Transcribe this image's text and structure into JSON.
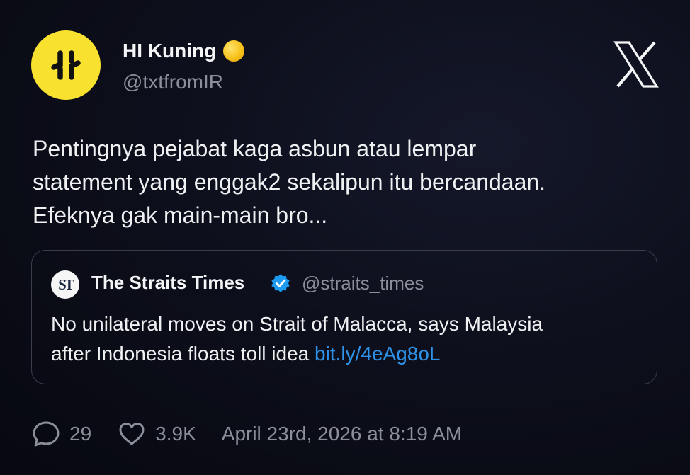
{
  "author": {
    "display_name": "HI Kuning",
    "handle": "@txtfromIR",
    "avatar_color": "#f9e12f",
    "badge_icon": "yellow-circle-emoji-icon"
  },
  "platform_logo": "x-logo-icon",
  "tweet": {
    "lines": [
      "Pentingnya pejabat kaga asbun atau lempar",
      "statement yang enggak2 sekalipun itu bercandaan.",
      "Efeknya gak main-main bro..."
    ]
  },
  "quote": {
    "avatar_text": "ST",
    "display_name": "The Straits Times",
    "verified_icon": "verified-badge-icon",
    "handle": "@straits_times",
    "line1": "No unilateral moves on Strait of Malacca, says Malaysia",
    "line2_text": "after Indonesia floats toll idea ",
    "link": "bit.ly/4eAg8oL",
    "link_color": "#2e93e8"
  },
  "footer": {
    "reply_icon": "reply-bubble-icon",
    "reply_count": "29",
    "like_icon": "heart-icon",
    "like_count": "3.9K",
    "timestamp": "April 23rd, 2026 at 8:19 AM"
  }
}
